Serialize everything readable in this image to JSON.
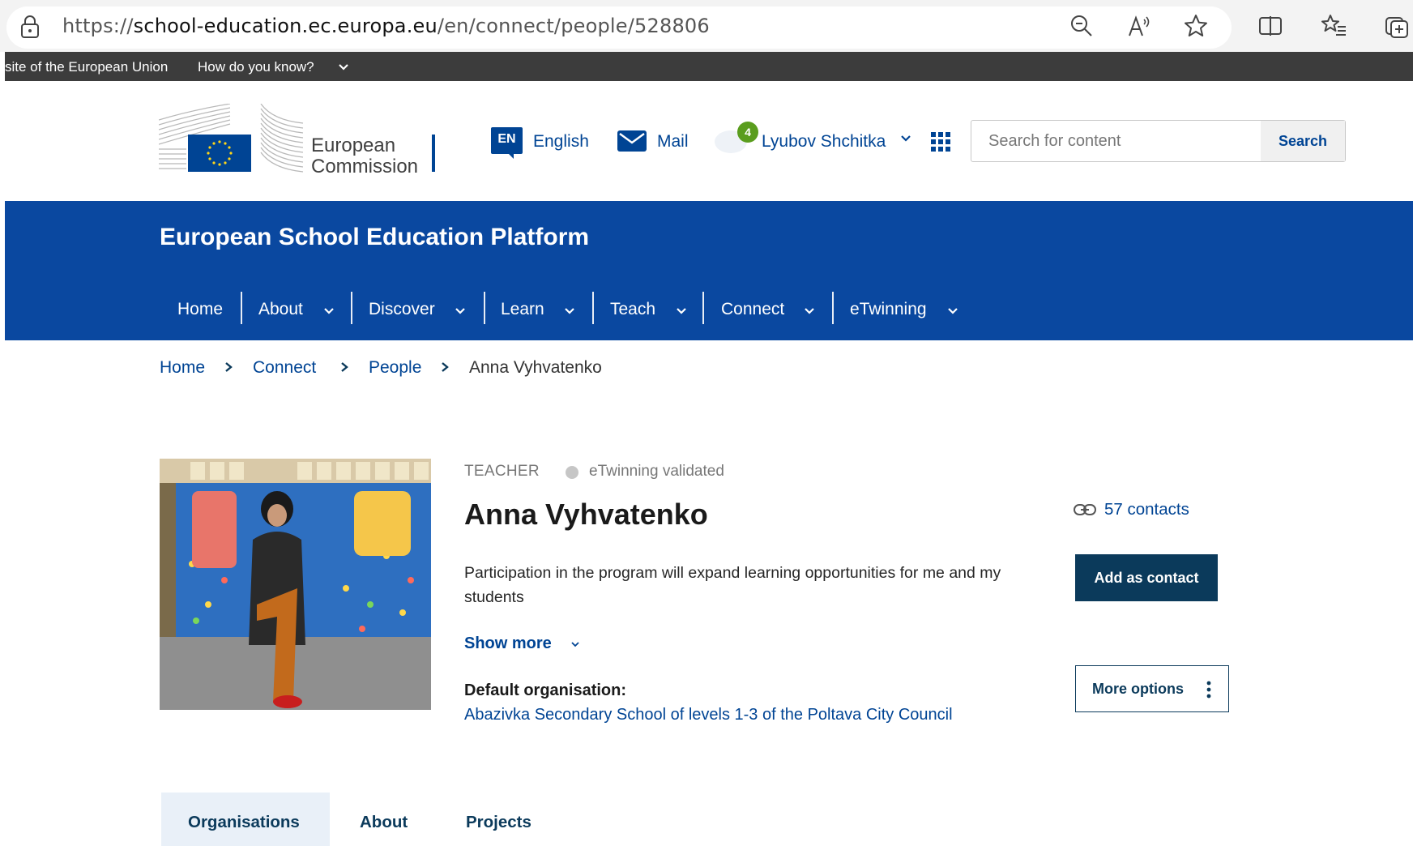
{
  "browser": {
    "url_prefix": "https://",
    "url_host": "school-education.ec.europa.eu",
    "url_path": "/en/connect/people/528806"
  },
  "eu_banner": {
    "text": "site of the European Union",
    "link": "How do you know?"
  },
  "header": {
    "logo_line1": "European",
    "logo_line2": "Commission",
    "lang_code": "EN",
    "lang_label": "English",
    "mail_label": "Mail",
    "notification_count": "4",
    "user_name": "Lyubov Shchitka",
    "search_placeholder": "Search for content",
    "search_button": "Search"
  },
  "site": {
    "title": "European School Education Platform",
    "nav": [
      {
        "label": "Home"
      },
      {
        "label": "About"
      },
      {
        "label": "Discover"
      },
      {
        "label": "Learn"
      },
      {
        "label": "Teach"
      },
      {
        "label": "Connect"
      },
      {
        "label": "eTwinning"
      }
    ]
  },
  "breadcrumb": [
    "Home",
    "Connect",
    "People",
    "Anna Vyhvatenko"
  ],
  "profile": {
    "role": "TEACHER",
    "validation": "eTwinning validated",
    "name": "Anna Vyhvatenko",
    "bio": "Participation in the program will expand learning opportunities for me and my students",
    "show_more": "Show more",
    "default_org_heading": "Default organisation:",
    "default_org": "Abazivka Secondary School of levels 1-3 of the Poltava City Council",
    "contacts": "57 contacts",
    "add_contact": "Add as contact",
    "more_options": "More options"
  },
  "tabs": [
    {
      "label": "Organisations",
      "active": true
    },
    {
      "label": "About",
      "active": false
    },
    {
      "label": "Projects",
      "active": false
    }
  ],
  "colors": {
    "brand_blue": "#0a48a0",
    "link_blue": "#004494",
    "dark_button": "#0b3a5b",
    "notification_green": "#5a9d1e"
  }
}
